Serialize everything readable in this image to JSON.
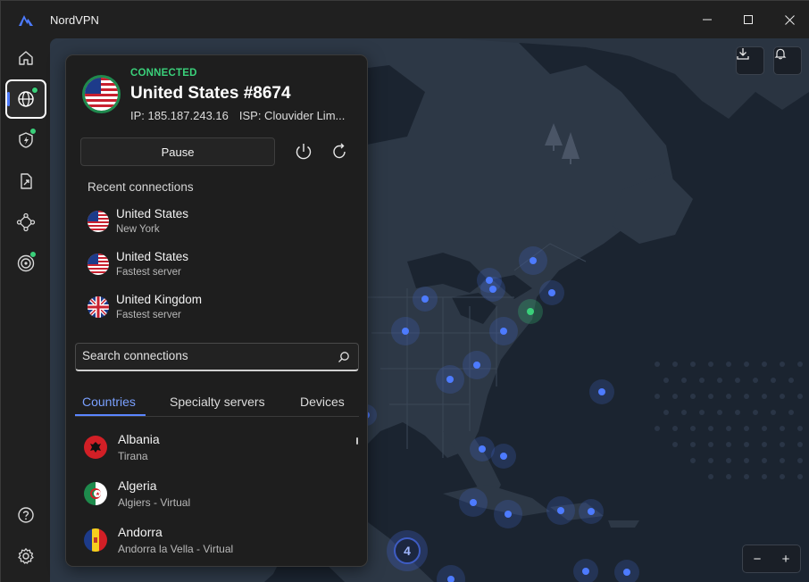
{
  "window": {
    "title": "NordVPN",
    "controls": {
      "minimize": "─",
      "maximize": "☐",
      "close": "✕"
    }
  },
  "sidebar": {
    "items": [
      {
        "name": "home",
        "icon": "home-icon",
        "active": false
      },
      {
        "name": "servers",
        "icon": "globe-icon",
        "active": true,
        "dot": true
      },
      {
        "name": "threat-protection",
        "icon": "shield-icon",
        "active": false,
        "dot": true
      },
      {
        "name": "file-share",
        "icon": "file-share-icon",
        "active": false
      },
      {
        "name": "meshnet",
        "icon": "meshnet-icon",
        "active": false
      },
      {
        "name": "dark-web-monitor",
        "icon": "target-icon",
        "active": false,
        "dot": true
      },
      {
        "name": "help",
        "icon": "help-icon",
        "active": false
      },
      {
        "name": "settings",
        "icon": "gear-icon",
        "active": false
      }
    ]
  },
  "connection": {
    "status": "CONNECTED",
    "server": "United States #8674",
    "ip_label": "IP: 185.187.243.16",
    "isp_label": "ISP: Clouvider Lim...",
    "pause_label": "Pause"
  },
  "recent": {
    "title": "Recent connections",
    "items": [
      {
        "country": "United States",
        "detail": "New York",
        "flag": "us"
      },
      {
        "country": "United States",
        "detail": "Fastest server",
        "flag": "us"
      },
      {
        "country": "United Kingdom",
        "detail": "Fastest server",
        "flag": "uk"
      }
    ]
  },
  "search": {
    "placeholder": "Search connections"
  },
  "tabs": [
    {
      "label": "Countries",
      "active": true
    },
    {
      "label": "Specialty servers",
      "active": false
    },
    {
      "label": "Devices",
      "active": false
    }
  ],
  "countries": [
    {
      "name": "Albania",
      "detail": "Tirana",
      "flag": "al"
    },
    {
      "name": "Algeria",
      "detail": "Algiers - Virtual",
      "flag": "dz"
    },
    {
      "name": "Andorra",
      "detail": "Andorra la Vella - Virtual",
      "flag": "ad"
    }
  ],
  "map": {
    "cluster_count": "4",
    "zoom_out": "−",
    "zoom_in": "+"
  },
  "colors": {
    "accent": "#5b86ff",
    "connected": "#3ad07a",
    "map_bg": "#1b2430",
    "land": "#2d3846"
  }
}
